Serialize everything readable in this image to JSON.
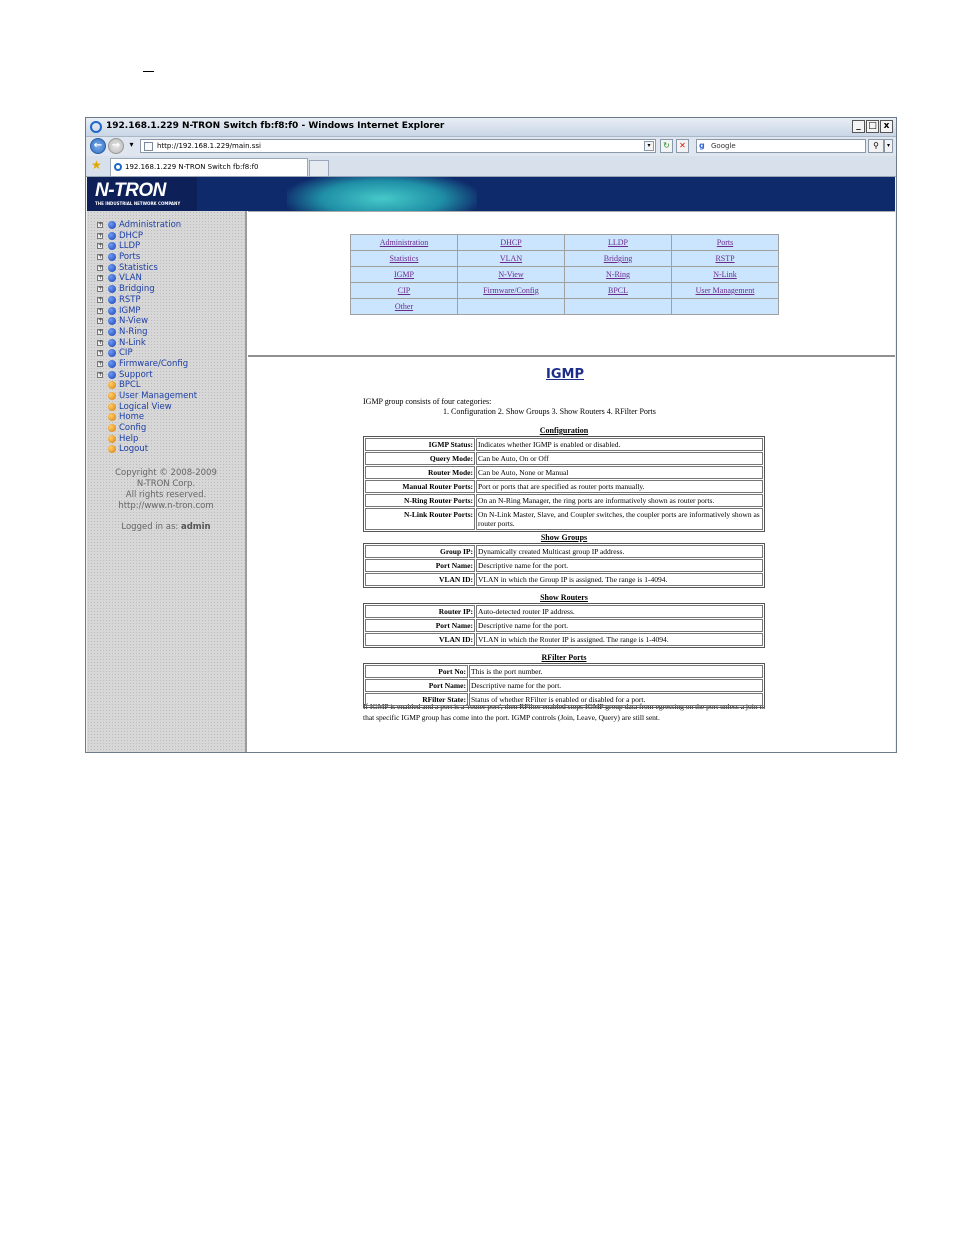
{
  "window": {
    "title": "192.168.1.229 N-TRON Switch fb:f8:f0 - Windows Internet Explorer",
    "minimize": "_",
    "maximize": "□",
    "close": "x"
  },
  "address": {
    "url": "http://192.168.1.229/main.ssi",
    "search_placeholder": "Google"
  },
  "tab": {
    "title": "192.168.1.229 N-TRON Switch fb:f8:f0"
  },
  "logo": {
    "name": "N-TRON",
    "tagline": "THE INDUSTRIAL NETWORK COMPANY"
  },
  "sidebar": {
    "items": [
      {
        "label": "Administration",
        "expandable": true,
        "color": "blue"
      },
      {
        "label": "DHCP",
        "expandable": true,
        "color": "blue"
      },
      {
        "label": "LLDP",
        "expandable": true,
        "color": "blue"
      },
      {
        "label": "Ports",
        "expandable": true,
        "color": "blue"
      },
      {
        "label": "Statistics",
        "expandable": true,
        "color": "blue"
      },
      {
        "label": "VLAN",
        "expandable": true,
        "color": "blue"
      },
      {
        "label": "Bridging",
        "expandable": true,
        "color": "blue"
      },
      {
        "label": "RSTP",
        "expandable": true,
        "color": "blue"
      },
      {
        "label": "IGMP",
        "expandable": true,
        "color": "blue"
      },
      {
        "label": "N-View",
        "expandable": true,
        "color": "blue"
      },
      {
        "label": "N-Ring",
        "expandable": true,
        "color": "blue"
      },
      {
        "label": "N-Link",
        "expandable": true,
        "color": "blue"
      },
      {
        "label": "CIP",
        "expandable": true,
        "color": "blue"
      },
      {
        "label": "Firmware/Config",
        "expandable": true,
        "color": "blue"
      },
      {
        "label": "Support",
        "expandable": true,
        "color": "blue"
      },
      {
        "label": "BPCL",
        "expandable": false,
        "color": "orange"
      },
      {
        "label": "User Management",
        "expandable": false,
        "color": "orange"
      },
      {
        "label": "Logical View",
        "expandable": false,
        "color": "orange"
      },
      {
        "label": "Home",
        "expandable": false,
        "color": "orange"
      },
      {
        "label": "Config",
        "expandable": false,
        "color": "orange"
      },
      {
        "label": "Help",
        "expandable": false,
        "color": "orange"
      },
      {
        "label": "Logout",
        "expandable": false,
        "color": "orange"
      }
    ],
    "copyright": "Copyright © 2008-2009",
    "company": "N-TRON Corp.",
    "rights": "All rights reserved.",
    "website": "http://www.n-tron.com",
    "logged_in_label": "Logged in as:",
    "logged_in_user": "admin"
  },
  "nav_links": [
    [
      "Administration",
      "DHCP",
      "LLDP",
      "Ports"
    ],
    [
      "Statistics",
      "VLAN",
      "Bridging",
      "RSTP"
    ],
    [
      "IGMP",
      "N-View",
      "N-Ring",
      "N-Link"
    ],
    [
      "CIP",
      "Firmware/Config",
      "BPCL",
      "User Management"
    ],
    [
      "Other",
      "",
      "",
      ""
    ]
  ],
  "main": {
    "title": "IGMP",
    "intro_line1": "IGMP group consists of four categories:",
    "intro_line2": "1. Configuration   2. Show Groups   3. Show Routers   4. RFilter Ports",
    "sections": [
      {
        "heading": "Configuration",
        "rows": [
          [
            "IGMP Status:",
            "Indicates whether IGMP is enabled or disabled."
          ],
          [
            "Query Mode:",
            "Can be Auto, On or Off"
          ],
          [
            "Router Mode:",
            "Can be Auto, None or Manual"
          ],
          [
            "Manual Router Ports:",
            "Port or ports that are specified as router ports manually."
          ],
          [
            "N-Ring Router Ports:",
            "On an N-Ring Manager, the ring ports are informatively shown as router ports."
          ],
          [
            "N-Link Router Ports:",
            "On N-Link Master, Slave, and Coupler switches, the coupler ports are informatively shown as router ports."
          ]
        ]
      },
      {
        "heading": "Show Groups",
        "rows": [
          [
            "Group IP:",
            "Dynamically created Multicast group IP address."
          ],
          [
            "Port Name:",
            "Descriptive name for the port."
          ],
          [
            "VLAN ID:",
            "VLAN in which the Group IP is assigned. The range is 1-4094."
          ]
        ]
      },
      {
        "heading": "Show Routers",
        "rows": [
          [
            "Router IP:",
            "Auto-detected router IP address."
          ],
          [
            "Port Name:",
            "Descriptive name for the port."
          ],
          [
            "VLAN ID:",
            "VLAN in which the Router IP is assigned. The range is 1-4094."
          ]
        ]
      },
      {
        "heading": "RFilter Ports",
        "rows": [
          [
            "Port No:",
            "This is the port number."
          ],
          [
            "Port Name:",
            "Descriptive name for the port."
          ],
          [
            "RFilter State:",
            "Status of whether RFilter is enabled or disabled for a port."
          ]
        ]
      }
    ],
    "footnote": "If IGMP is enabled and a port is a 'router port', then RFilter enabled stops IGMP group data from egressing on the port unless a join to that specific IGMP group has come into the port. IGMP controls (Join, Leave, Query) are still sent."
  }
}
